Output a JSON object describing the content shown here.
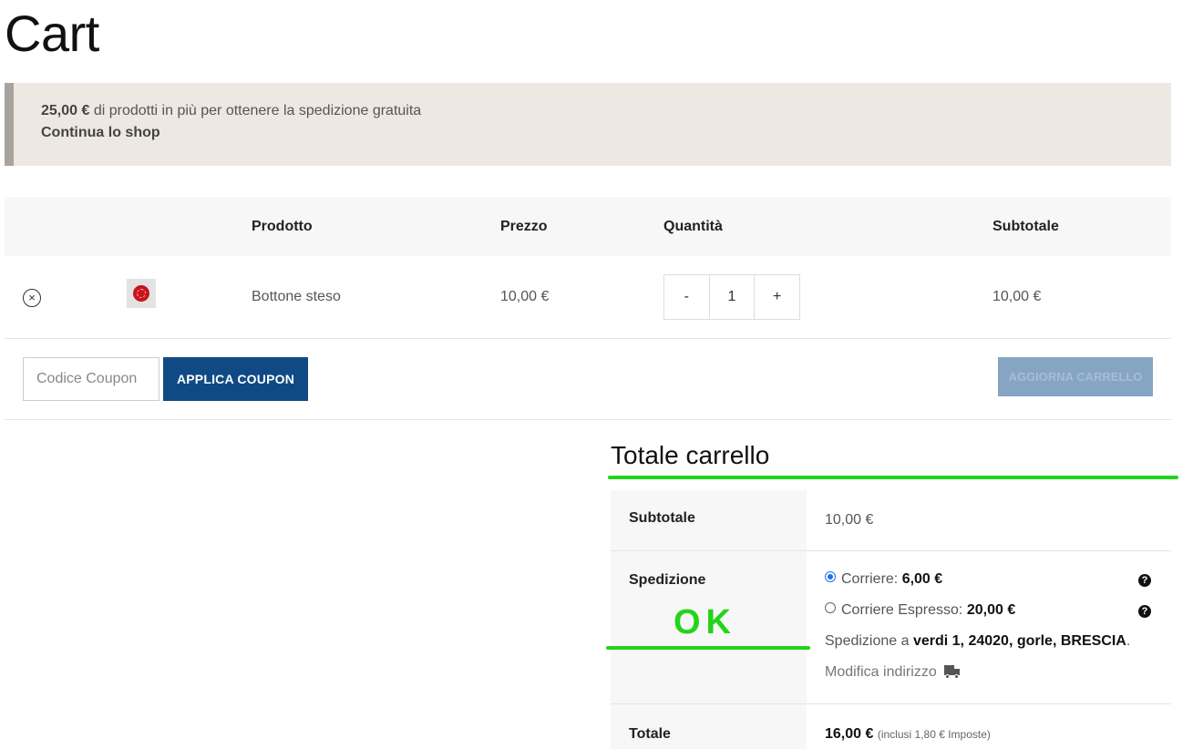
{
  "page": {
    "title": "Cart"
  },
  "notice": {
    "amount": "25,00 €",
    "message": " di prodotti in più per ottenere la spedizione gratuita",
    "link": "Continua lo shop"
  },
  "table": {
    "headers": {
      "product": "Prodotto",
      "price": "Prezzo",
      "quantity": "Quantità",
      "subtotal": "Subtotale"
    },
    "rows": [
      {
        "remove": "×",
        "name": "Bottone steso",
        "price": "10,00 €",
        "quantity": "1",
        "subtotal": "10,00 €"
      }
    ],
    "qty_minus": "-",
    "qty_plus": "+"
  },
  "actions": {
    "coupon_placeholder": "Codice Coupon",
    "apply_label": "APPLICA COUPON",
    "update_label": "AGGIORNA CARRELLO"
  },
  "totals": {
    "title": "Totale carrello",
    "subtotal_label": "Subtotale",
    "subtotal_value": "10,00 €",
    "shipping_label": "Spedizione",
    "options": [
      {
        "name": "Corriere: ",
        "price": "6,00 €",
        "selected": true
      },
      {
        "name": "Corriere Espresso: ",
        "price": "20,00 €",
        "selected": false
      }
    ],
    "help_glyph": "?",
    "ship_to_prefix": "Spedizione a ",
    "ship_to_address": "verdi 1, 24020, gorle, BRESCIA",
    "ship_to_suffix": ".",
    "edit_address": "Modifica indirizzo",
    "total_label": "Totale",
    "total_value": "16,00 €",
    "tax_note": "(inclusi 1,80 € Imposte)"
  },
  "annotation": {
    "ok_text": "OK",
    "color": "#22d41a"
  },
  "colors": {
    "primary_button": "#0f4a85",
    "disabled_button": "#86a5c3",
    "notice_bg": "#eee8e2"
  },
  "icons": {
    "remove": "close-circle-icon",
    "help": "question-circle-icon",
    "address": "truck-icon"
  }
}
